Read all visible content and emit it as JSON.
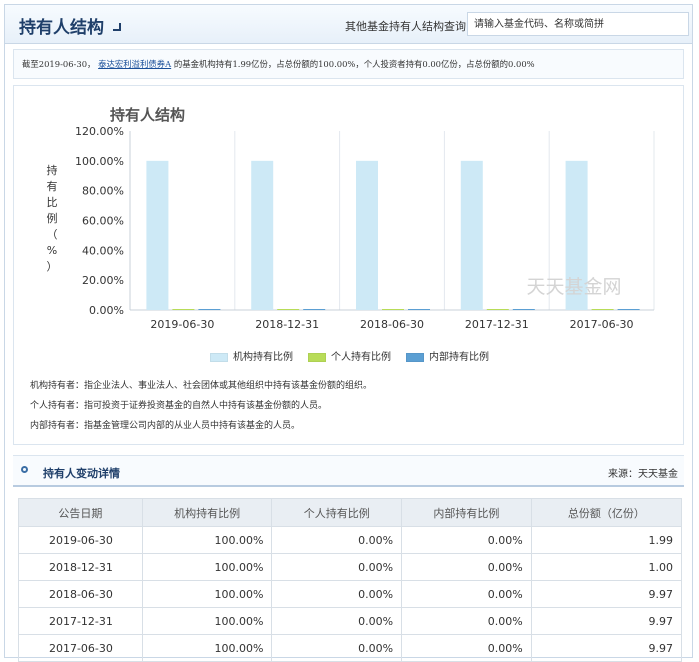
{
  "header": {
    "title": "持有人结构",
    "search_label": "其他基金持有人结构查询:",
    "search_placeholder": "请输入基金代码、名称或简拼"
  },
  "summary": {
    "prefix": "截至2019-06-30，",
    "fund_name": "泰达宏利溢利债券A",
    "suffix": "的基金机构持有1.99亿份，占总份额的100.00%，个人投资者持有0.00亿份，占总份额的0.00%"
  },
  "chart_data": {
    "type": "bar",
    "title": "持有人结构",
    "ylabel": "持有比例（%）",
    "watermark": "天天基金网",
    "categories": [
      "2019-06-30",
      "2018-12-31",
      "2018-06-30",
      "2017-12-31",
      "2017-06-30"
    ],
    "yticks": [
      "120.00%",
      "100.00%",
      "80.00%",
      "60.00%",
      "40.00%",
      "20.00%",
      "0.00%"
    ],
    "ylim": [
      0,
      120
    ],
    "series": [
      {
        "name": "机构持有比例",
        "color": "#cde9f6",
        "values": [
          100,
          100,
          100,
          100,
          100
        ]
      },
      {
        "name": "个人持有比例",
        "color": "#b8dc58",
        "values": [
          0,
          0,
          0,
          0,
          0
        ]
      },
      {
        "name": "内部持有比例",
        "color": "#5b9fd3",
        "values": [
          0,
          0,
          0,
          0,
          0
        ]
      }
    ],
    "grid": "vertical",
    "legend": "bottom"
  },
  "definitions": [
    "机构持有者：指企业法人、事业法人、社会团体或其他组织中持有该基金份额的组织。",
    "个人持有者：指可投资于证券投资基金的自然人中持有该基金份额的人员。",
    "内部持有者：指基金管理公司内部的从业人员中持有该基金的人员。"
  ],
  "detail": {
    "title": "持有人变动详情",
    "source_label": "来源：",
    "source_value": "天天基金",
    "columns": [
      "公告日期",
      "机构持有比例",
      "个人持有比例",
      "内部持有比例",
      "总份额（亿份）"
    ],
    "rows": [
      [
        "2019-06-30",
        "100.00%",
        "0.00%",
        "0.00%",
        "1.99"
      ],
      [
        "2018-12-31",
        "100.00%",
        "0.00%",
        "0.00%",
        "1.00"
      ],
      [
        "2018-06-30",
        "100.00%",
        "0.00%",
        "0.00%",
        "9.97"
      ],
      [
        "2017-12-31",
        "100.00%",
        "0.00%",
        "0.00%",
        "9.97"
      ],
      [
        "2017-06-30",
        "100.00%",
        "0.00%",
        "0.00%",
        "9.97"
      ]
    ]
  }
}
